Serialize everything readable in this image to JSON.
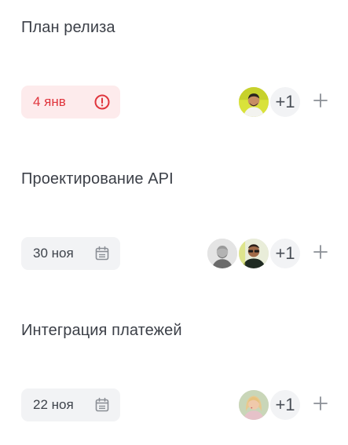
{
  "tasks": [
    {
      "title": "План релиза",
      "date": "4 янв",
      "date_icon": "alert-circle-icon",
      "assignees": [
        "avatar-yellow-man"
      ],
      "more": "+1",
      "add_icon": "plus-icon",
      "status_color": "#e0353d"
    },
    {
      "title": "Проектирование API",
      "date": "30 ноя",
      "date_icon": "calendar-icon",
      "assignees": [
        "avatar-grey-man",
        "avatar-man-sunglasses"
      ],
      "more": "+1",
      "add_icon": "plus-icon"
    },
    {
      "title": "Интеграция платежей",
      "date": "22 ноя",
      "date_icon": "calendar-icon",
      "assignees": [
        "avatar-blonde-woman"
      ],
      "more": "+1",
      "add_icon": "plus-icon"
    }
  ]
}
